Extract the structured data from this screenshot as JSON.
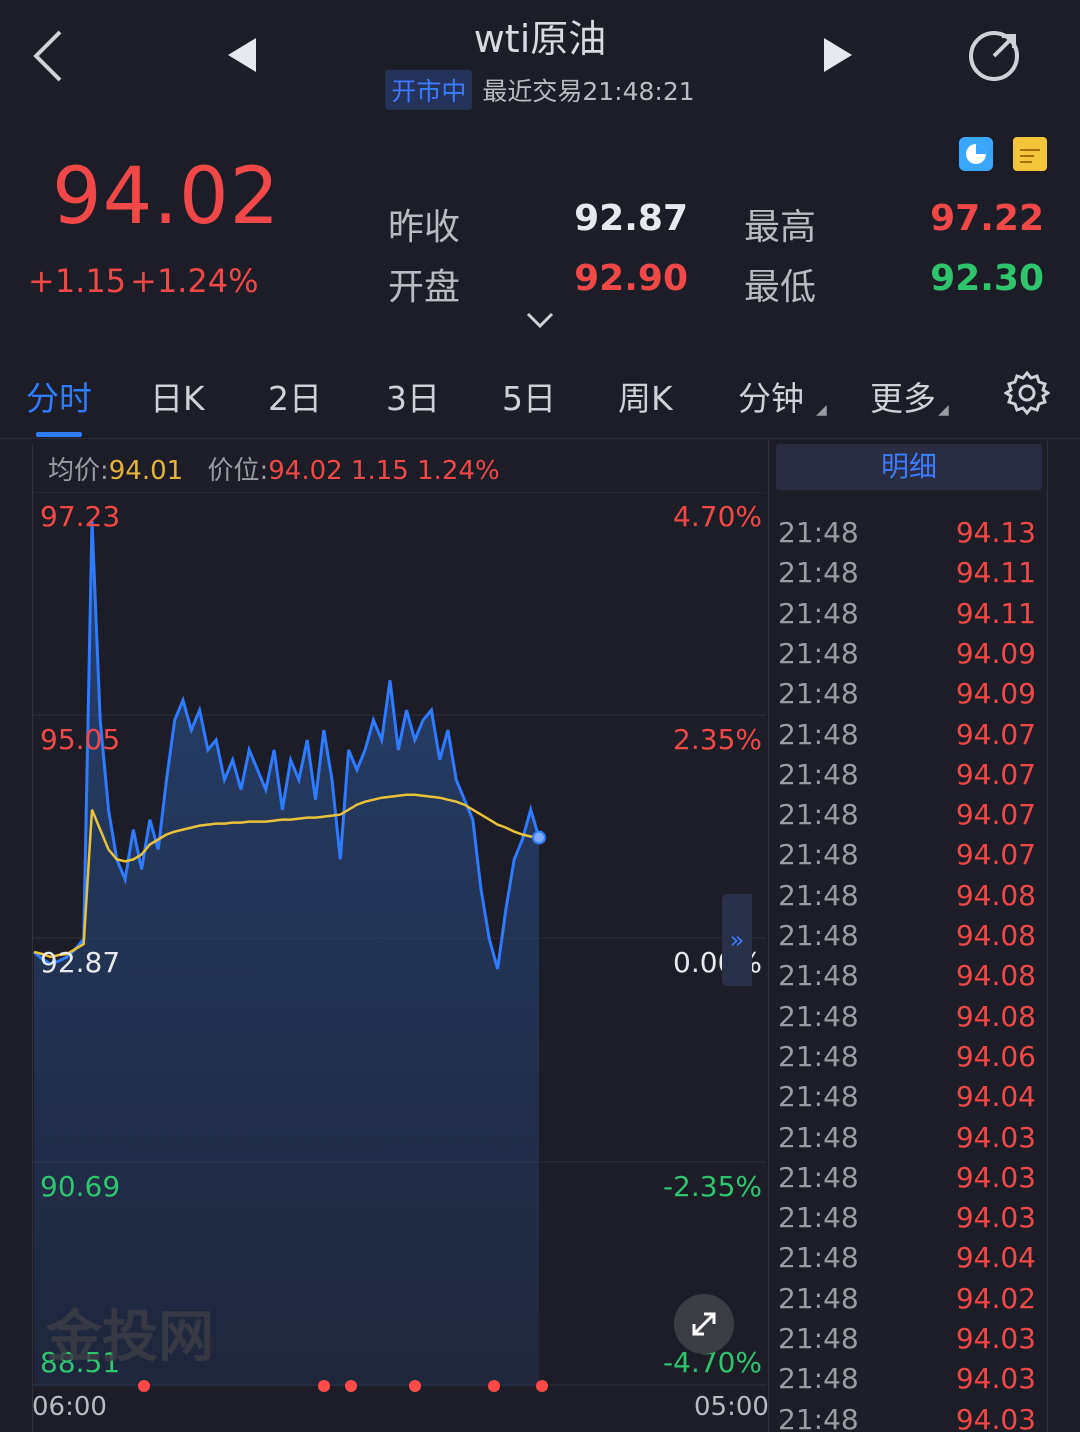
{
  "header": {
    "title": "wti原油",
    "status_badge": "开市中",
    "last_trade": "最近交易21:48:21"
  },
  "quote": {
    "price": "94.02",
    "change": "+1.15",
    "change_pct": "+1.24%",
    "prev_close_label": "昨收",
    "prev_close": "92.87",
    "open_label": "开盘",
    "open": "92.90",
    "high_label": "最高",
    "high": "97.22",
    "low_label": "最低",
    "low": "92.30"
  },
  "tabs": [
    {
      "label": "分时",
      "active": true
    },
    {
      "label": "日K"
    },
    {
      "label": "2日"
    },
    {
      "label": "3日"
    },
    {
      "label": "5日"
    },
    {
      "label": "周K"
    },
    {
      "label": "分钟"
    },
    {
      "label": "更多"
    }
  ],
  "chart_info": {
    "avg_label": "均价:",
    "avg_value": "94.01",
    "price_label": "价位:",
    "price_value": "94.02 1.15 1.24%"
  },
  "chart_data": {
    "type": "line",
    "y_left_ticks": [
      "97.23",
      "95.05",
      "92.87",
      "90.69",
      "88.51"
    ],
    "y_right_ticks": [
      "4.70%",
      "2.35%",
      "0.00%",
      "-2.35%",
      "-4.70%"
    ],
    "ylim": [
      88.51,
      97.23
    ],
    "x_start": "06:00",
    "x_end": "05:00",
    "series": [
      {
        "values": [
          92.87,
          92.8,
          92.75,
          92.78,
          92.82,
          92.9,
          93.0,
          97.2,
          95.2,
          94.3,
          93.8,
          93.6,
          94.1,
          93.7,
          94.2,
          93.9,
          94.6,
          95.2,
          95.4,
          95.1,
          95.3,
          94.9,
          95.0,
          94.6,
          94.8,
          94.5,
          94.9,
          94.7,
          94.5,
          94.9,
          94.3,
          94.8,
          94.6,
          95.0,
          94.4,
          95.1,
          94.6,
          93.8,
          94.9,
          94.7,
          94.9,
          95.2,
          95.0,
          95.6,
          94.9,
          95.3,
          95.0,
          95.2,
          95.3,
          94.8,
          95.1,
          94.6,
          94.4,
          94.2,
          93.5,
          93.0,
          92.7,
          93.3,
          93.8,
          94.0,
          94.3,
          94.02
        ]
      },
      {
        "values": [
          92.87,
          92.85,
          92.82,
          92.84,
          92.85,
          92.9,
          92.95,
          94.3,
          94.1,
          93.9,
          93.8,
          93.78,
          93.8,
          93.85,
          93.95,
          94.0,
          94.05,
          94.08,
          94.1,
          94.12,
          94.14,
          94.15,
          94.16,
          94.16,
          94.17,
          94.17,
          94.18,
          94.18,
          94.18,
          94.19,
          94.2,
          94.2,
          94.21,
          94.22,
          94.22,
          94.23,
          94.24,
          94.25,
          94.3,
          94.35,
          94.38,
          94.4,
          94.42,
          94.43,
          94.44,
          94.45,
          94.45,
          94.44,
          94.43,
          94.42,
          94.4,
          94.38,
          94.35,
          94.3,
          94.25,
          94.2,
          94.15,
          94.12,
          94.08,
          94.05,
          94.03,
          94.01
        ]
      }
    ],
    "colors": {
      "price": "#2f7bff",
      "avg": "#e8c23a"
    }
  },
  "detail": {
    "header": "明细",
    "rows": [
      {
        "time": "21:48",
        "price": "94.13"
      },
      {
        "time": "21:48",
        "price": "94.11"
      },
      {
        "time": "21:48",
        "price": "94.11"
      },
      {
        "time": "21:48",
        "price": "94.09"
      },
      {
        "time": "21:48",
        "price": "94.09"
      },
      {
        "time": "21:48",
        "price": "94.07"
      },
      {
        "time": "21:48",
        "price": "94.07"
      },
      {
        "time": "21:48",
        "price": "94.07"
      },
      {
        "time": "21:48",
        "price": "94.07"
      },
      {
        "time": "21:48",
        "price": "94.08"
      },
      {
        "time": "21:48",
        "price": "94.08"
      },
      {
        "time": "21:48",
        "price": "94.08"
      },
      {
        "time": "21:48",
        "price": "94.08"
      },
      {
        "time": "21:48",
        "price": "94.06"
      },
      {
        "time": "21:48",
        "price": "94.04"
      },
      {
        "time": "21:48",
        "price": "94.03"
      },
      {
        "time": "21:48",
        "price": "94.03"
      },
      {
        "time": "21:48",
        "price": "94.03"
      },
      {
        "time": "21:48",
        "price": "94.04"
      },
      {
        "time": "21:48",
        "price": "94.02"
      },
      {
        "time": "21:48",
        "price": "94.03"
      },
      {
        "time": "21:48",
        "price": "94.03"
      },
      {
        "time": "21:48",
        "price": "94.03"
      }
    ]
  },
  "watermark": "金投网"
}
